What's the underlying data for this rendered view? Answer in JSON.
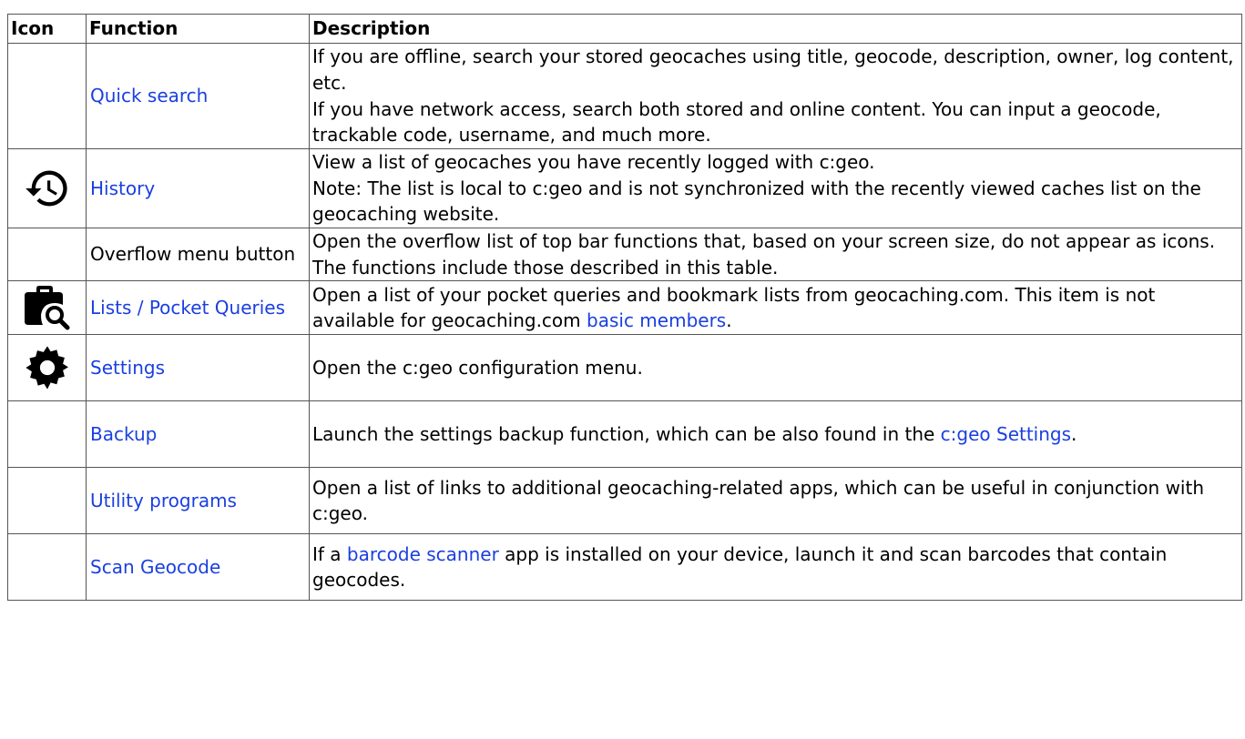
{
  "table": {
    "headers": [
      "Icon",
      "Function",
      "Description"
    ],
    "rows": [
      {
        "icon": "",
        "function": "Quick search",
        "function_is_link": true,
        "desc_lines": [
          "If you are offline, search your stored geocaches using title, geocode, description, owner, log content, etc.",
          "If you have network access, search both stored and online content. You can input a geocode, trackable code, username, and much more."
        ]
      },
      {
        "icon": "history-icon",
        "function": "History",
        "function_is_link": true,
        "desc_lines": [
          "View a list of geocaches you have recently logged with c:geo.",
          "Note: The list is local to c:geo and is not synchronized with the recently viewed caches list on the geocaching website."
        ]
      },
      {
        "icon": "",
        "function": "Overflow menu button",
        "function_is_link": false,
        "desc_lines": [
          "Open the overflow list of top bar functions that, based on your screen size, do not appear as icons. The functions include those described in this table."
        ]
      },
      {
        "icon": "briefcase-search-icon",
        "function": "Lists / Pocket Queries",
        "function_is_link": true,
        "desc_before": "Open a list of your pocket queries and bookmark lists from geocaching.com. This item is not available for geocaching.com ",
        "desc_link": "basic members",
        "desc_after": "."
      },
      {
        "icon": "gear-icon",
        "function": "Settings",
        "function_is_link": true,
        "desc_lines": [
          "Open the c:geo configuration menu."
        ]
      },
      {
        "icon": "",
        "function": "Backup",
        "function_is_link": true,
        "desc_before": "Launch the settings backup function, which can be also found in the ",
        "desc_link": "c:geo Settings",
        "desc_after": "."
      },
      {
        "icon": "",
        "function": "Utility programs",
        "function_is_link": true,
        "desc_lines": [
          "Open a list of links to additional geocaching-related apps, which can be useful in conjunction with c:geo."
        ]
      },
      {
        "icon": "",
        "function": "Scan Geocode",
        "function_is_link": true,
        "desc_before": "If a ",
        "desc_link": "barcode scanner",
        "desc_after": " app is installed on your device, launch it and scan barcodes that contain geocodes."
      }
    ]
  }
}
